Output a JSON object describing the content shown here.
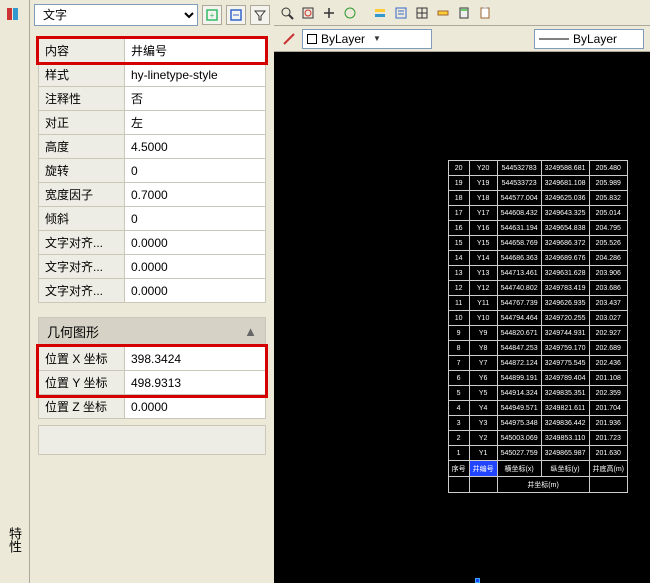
{
  "left_bar": {
    "label": "特性"
  },
  "props": {
    "object_type": "文字",
    "section_geom": "几何图形",
    "rows": [
      {
        "label": "内容",
        "value": "井编号"
      },
      {
        "label": "样式",
        "value": "hy-linetype-style"
      },
      {
        "label": "注释性",
        "value": "否"
      },
      {
        "label": "对正",
        "value": "左"
      },
      {
        "label": "高度",
        "value": "4.5000"
      },
      {
        "label": "旋转",
        "value": "0"
      },
      {
        "label": "宽度因子",
        "value": "0.7000"
      },
      {
        "label": "倾斜",
        "value": "0"
      },
      {
        "label": "文字对齐...",
        "value": "0.0000"
      },
      {
        "label": "文字对齐...",
        "value": "0.0000"
      },
      {
        "label": "文字对齐...",
        "value": "0.0000"
      }
    ],
    "geom_rows": [
      {
        "label": "位置 X 坐标",
        "value": "398.3424"
      },
      {
        "label": "位置 Y 坐标",
        "value": "498.9313"
      },
      {
        "label": "位置 Z 坐标",
        "value": "0.0000"
      }
    ]
  },
  "sub_toolbar": {
    "layer_left": "ByLayer",
    "layer_right": "ByLayer"
  },
  "cad_table": {
    "rows": [
      [
        "20",
        "Y20",
        "544532783",
        "3249588.681",
        "205.480"
      ],
      [
        "19",
        "Y19",
        "544533723",
        "3249681.108",
        "205.989"
      ],
      [
        "18",
        "Y18",
        "544577.004",
        "3249625.036",
        "205.832"
      ],
      [
        "17",
        "Y17",
        "544608.432",
        "3249643.325",
        "205.014"
      ],
      [
        "16",
        "Y16",
        "544631.194",
        "3249654.838",
        "204.795"
      ],
      [
        "15",
        "Y15",
        "544658.769",
        "3249686.372",
        "205.526"
      ],
      [
        "14",
        "Y14",
        "544686.363",
        "3249689.676",
        "204.286"
      ],
      [
        "13",
        "Y13",
        "544713.461",
        "3249631.628",
        "203.906"
      ],
      [
        "12",
        "Y12",
        "544740.802",
        "3249783.419",
        "203.686"
      ],
      [
        "11",
        "Y11",
        "544767.739",
        "3249626.935",
        "203.437"
      ],
      [
        "10",
        "Y10",
        "544794.464",
        "3249720.255",
        "203.027"
      ],
      [
        "9",
        "Y9",
        "544820.671",
        "3249744.931",
        "202.927"
      ],
      [
        "8",
        "Y8",
        "544847.253",
        "3249759.170",
        "202.689"
      ],
      [
        "7",
        "Y7",
        "544872.124",
        "3249775.545",
        "202.436"
      ],
      [
        "6",
        "Y6",
        "544899.191",
        "3249789.404",
        "201.108"
      ],
      [
        "5",
        "Y5",
        "544914.324",
        "3249835.351",
        "202.359"
      ],
      [
        "4",
        "Y4",
        "544949.571",
        "3249821.611",
        "201.704"
      ],
      [
        "3",
        "Y3",
        "544975.348",
        "3249836.442",
        "201.936"
      ],
      [
        "2",
        "Y2",
        "545003.069",
        "3249853.110",
        "201.723"
      ],
      [
        "1",
        "Y1",
        "545027.759",
        "3249865.987",
        "201.630"
      ]
    ],
    "footer1": [
      "序号",
      "井编号",
      "横坐标(x)",
      "纵坐标(y)",
      "井底高(m)"
    ],
    "footer2": "井坐标(m)"
  }
}
